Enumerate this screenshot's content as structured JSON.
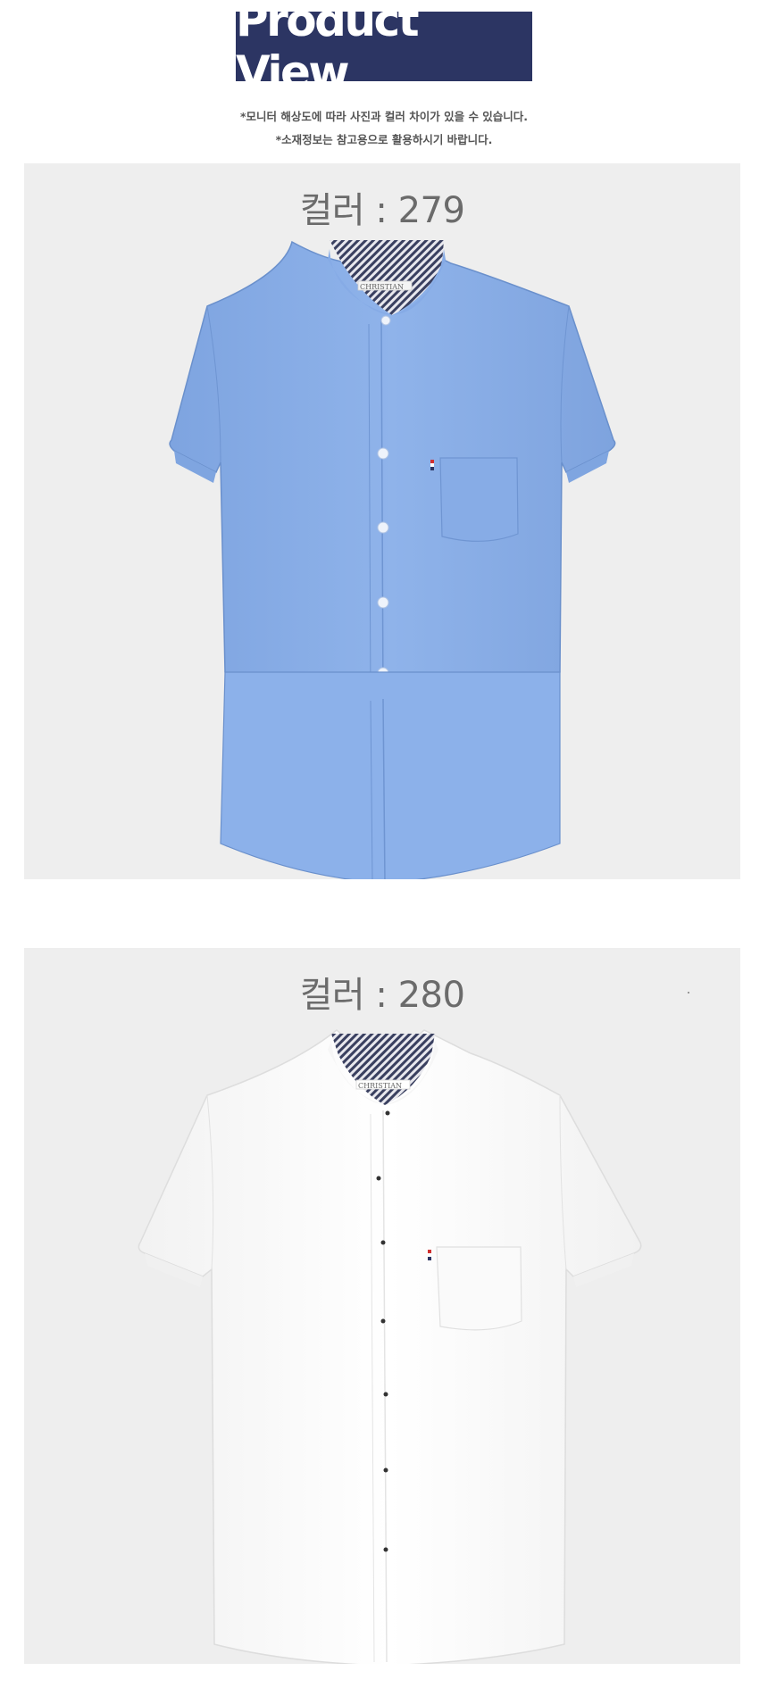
{
  "header": {
    "title": "Product View",
    "banner_color": "#2c3563"
  },
  "notices": [
    "*모니터 해상도에 따라 사진과 컬러 차이가 있을 수 있습니다.",
    "*소재정보는 참고용으로 활용하시기 바랍니다."
  ],
  "products": [
    {
      "color_label": "컬러 : 279",
      "shirt_color": "#8bb0e8",
      "brand_tag": "CHRISTIAN"
    },
    {
      "color_label": "컬러 : 280",
      "shirt_color": "#fafafa",
      "brand_tag": "CHRISTIAN"
    }
  ]
}
